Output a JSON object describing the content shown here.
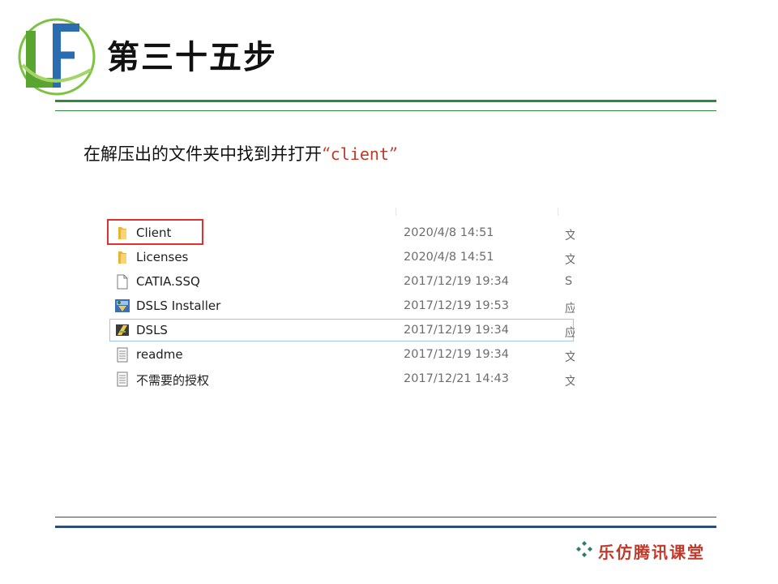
{
  "header": {
    "logo_letters": "LF",
    "title": "第三十五步"
  },
  "instruction": {
    "prefix": "在解压出的文件夹中找到并打开",
    "quote_open": "“",
    "target": "client",
    "quote_close": "”"
  },
  "explorer": {
    "files": [
      {
        "name": "Client",
        "date": "2020/4/8 14:51",
        "type": "文",
        "icon": "folder-icon"
      },
      {
        "name": "Licenses",
        "date": "2020/4/8 14:51",
        "type": "文",
        "icon": "folder-icon"
      },
      {
        "name": "CATIA.SSQ",
        "date": "2017/12/19 19:34",
        "type": "S",
        "icon": "file-icon"
      },
      {
        "name": "DSLS Installer",
        "date": "2017/12/19 19:53",
        "type": "应",
        "icon": "installer-icon"
      },
      {
        "name": "DSLS",
        "date": "2017/12/19 19:34",
        "type": "应",
        "icon": "app-icon"
      },
      {
        "name": "readme",
        "date": "2017/12/19 19:34",
        "type": "文",
        "icon": "text-file-icon"
      },
      {
        "name": "不需要的授权",
        "date": "2017/12/21 14:43",
        "type": "文",
        "icon": "text-file-icon"
      }
    ],
    "highlighted_item": "Client",
    "focused_item": "DSLS"
  },
  "footer": {
    "brand": "乐仿腾讯课堂"
  },
  "colors": {
    "green_rule": "#2e8b3a",
    "blue_rule": "#2d4e7a",
    "highlight_red": "#e03030",
    "brand_red": "#c0392b"
  }
}
